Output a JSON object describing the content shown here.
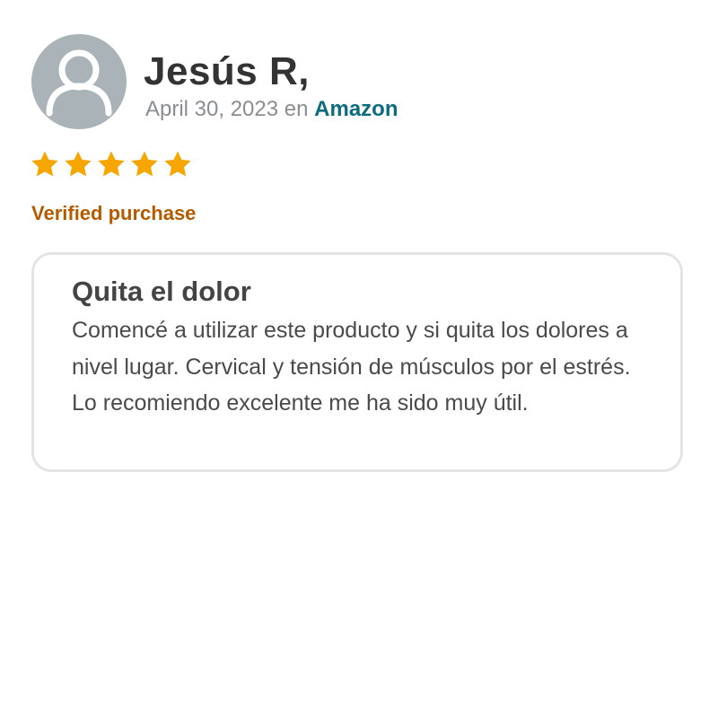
{
  "review": {
    "reviewer_name": "Jesús R,",
    "date": "April 30, 2023",
    "source_prefix": "en",
    "source": "Amazon",
    "rating": 5,
    "rating_max": 5,
    "verified_label": "Verified purchase",
    "title": "Quita el dolor",
    "body": "Comencé a utilizar este producto y si quita los dolores a nivel lugar. Cervical y tensión de músculos por el estrés. Lo recomiendo excelente me ha sido muy útil."
  },
  "icons": {
    "avatar": "user-avatar-icon",
    "star": "star-icon"
  },
  "colors": {
    "star": "#f7a600",
    "verified": "#b65a00",
    "source_link": "#0e6b7f",
    "avatar_bg": "#a9b3b8",
    "card_border": "#e4e4e4"
  }
}
